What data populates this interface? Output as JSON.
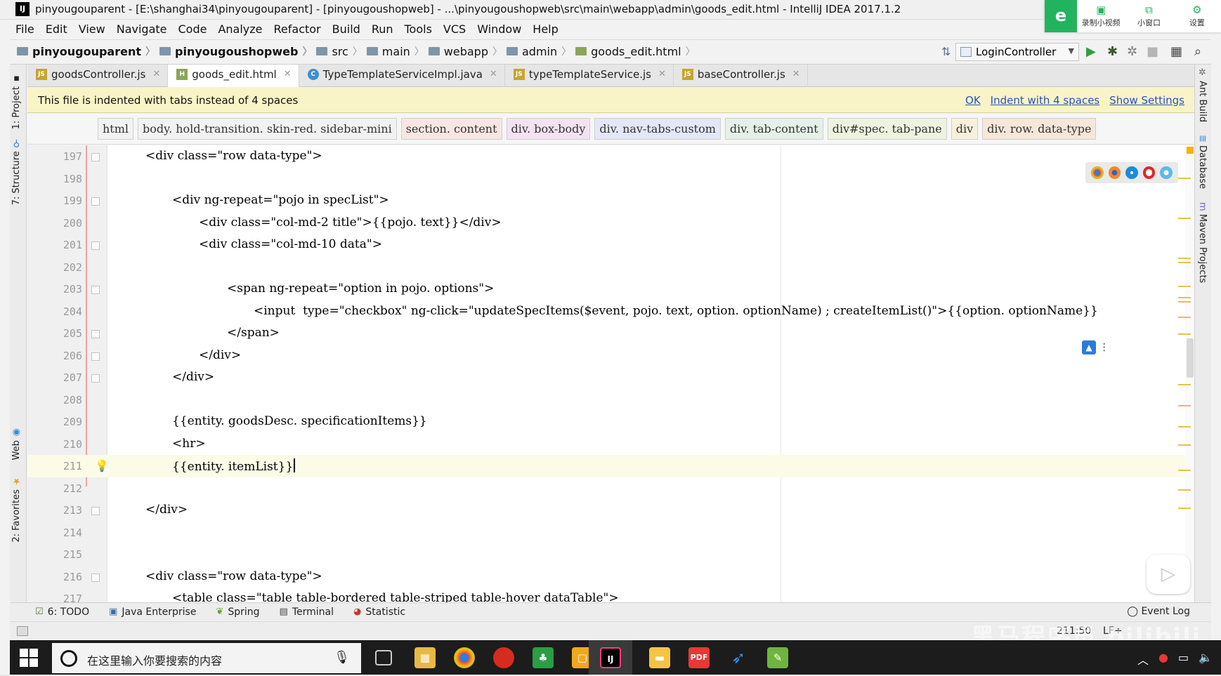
{
  "window": {
    "app_icon": "IJ",
    "title": "pinyougouparent - [E:\\shanghai34\\pinyougouparent] - [pinyougoushopweb] - ...\\pinyougoushopweb\\src\\main\\webapp\\admin\\goods_edit.html - IntelliJ IDEA 2017.1.2"
  },
  "recorder": {
    "logo": "e",
    "items": [
      {
        "icon": "video-icon",
        "label": "录制小视频"
      },
      {
        "icon": "window-icon",
        "label": "小窗口"
      },
      {
        "icon": "gear-icon",
        "label": "设置"
      }
    ]
  },
  "menu": [
    "File",
    "Edit",
    "View",
    "Navigate",
    "Code",
    "Analyze",
    "Refactor",
    "Build",
    "Run",
    "Tools",
    "VCS",
    "Window",
    "Help"
  ],
  "breadcrumbs": [
    {
      "label": "pinyougouparent",
      "bold": true
    },
    {
      "label": "pinyougoushopweb",
      "bold": true
    },
    {
      "label": "src"
    },
    {
      "label": "main"
    },
    {
      "label": "webapp"
    },
    {
      "label": "admin"
    },
    {
      "label": "goods_edit.html"
    }
  ],
  "run_config": "LoginController",
  "tabs": [
    {
      "label": "goodsController.js",
      "type": "JS",
      "color": "#c8a52c"
    },
    {
      "label": "goods_edit.html",
      "type": "H",
      "color": "#8aa657",
      "active": true
    },
    {
      "label": "TypeTemplateServiceImpl.java",
      "type": "C",
      "color": "#3b8fd0"
    },
    {
      "label": "typeTemplateService.js",
      "type": "JS",
      "color": "#c8a52c"
    },
    {
      "label": "baseController.js",
      "type": "JS",
      "color": "#c8a52c"
    }
  ],
  "notice": {
    "message": "This file is indented with tabs instead of 4 spaces",
    "actions": [
      "OK",
      "Indent with 4 spaces",
      "Show Settings"
    ]
  },
  "tag_breadcrumbs": [
    "html",
    "body. hold-transition. skin-red. sidebar-mini",
    "section. content",
    "div. box-body",
    "div. nav-tabs-custom",
    "div. tab-content",
    "div#spec. tab-pane",
    "div",
    "div. row. data-type"
  ],
  "side_tabs": {
    "left": [
      "1: Project",
      "7: Structure",
      "Web",
      "2: Favorites"
    ],
    "right": [
      "Ant Build",
      "Database",
      "Maven Projects"
    ]
  },
  "editor": {
    "lines": [
      {
        "n": "197",
        "text": "<div class=\"row data-type\">"
      },
      {
        "n": "198",
        "text": ""
      },
      {
        "n": "199",
        "text": "<div ng-repeat=\"pojo in specList\">"
      },
      {
        "n": "200",
        "text": "<div class=\"col-md-2 title\">{{pojo. text}}</div>"
      },
      {
        "n": "201",
        "text": "<div class=\"col-md-10 data\">"
      },
      {
        "n": "202",
        "text": ""
      },
      {
        "n": "203",
        "text": "<span ng-repeat=\"option in pojo. options\">"
      },
      {
        "n": "204",
        "text": "<input  type=\"checkbox\" ng-click=\"updateSpecItems($event, pojo. text, option. optionName) ; createItemList()\">{{option. optionName}}"
      },
      {
        "n": "205",
        "text": "</span>"
      },
      {
        "n": "206",
        "text": "</div>"
      },
      {
        "n": "207",
        "text": "</div>"
      },
      {
        "n": "208",
        "text": ""
      },
      {
        "n": "209",
        "text": "{{entity. goodsDesc. specificationItems}}"
      },
      {
        "n": "210",
        "text": "<hr>"
      },
      {
        "n": "211",
        "text": "{{entity. itemList}}"
      },
      {
        "n": "212",
        "text": ""
      },
      {
        "n": "213",
        "text": "</div>"
      },
      {
        "n": "214",
        "text": ""
      },
      {
        "n": "215",
        "text": ""
      },
      {
        "n": "216",
        "text": "<div class=\"row data-type\">"
      },
      {
        "n": "217",
        "text": "<table class=\"table table-bordered table-striped table-hover dataTable\">"
      }
    ]
  },
  "bottom_tools": [
    {
      "icon": "todo-icon",
      "label": "6: TODO"
    },
    {
      "icon": "java-enterprise-icon",
      "label": "Java Enterprise"
    },
    {
      "icon": "spring-icon",
      "label": "Spring"
    },
    {
      "icon": "terminal-icon",
      "label": "Terminal"
    },
    {
      "icon": "statistic-icon",
      "label": "Statistic"
    }
  ],
  "event_log": "Event Log",
  "status": {
    "position": "211:50",
    "line_sep": "LF÷"
  },
  "watermark": "黑马程序员 bilibili",
  "taskbar": {
    "search_placeholder": "在这里输入你要搜索的内容"
  }
}
